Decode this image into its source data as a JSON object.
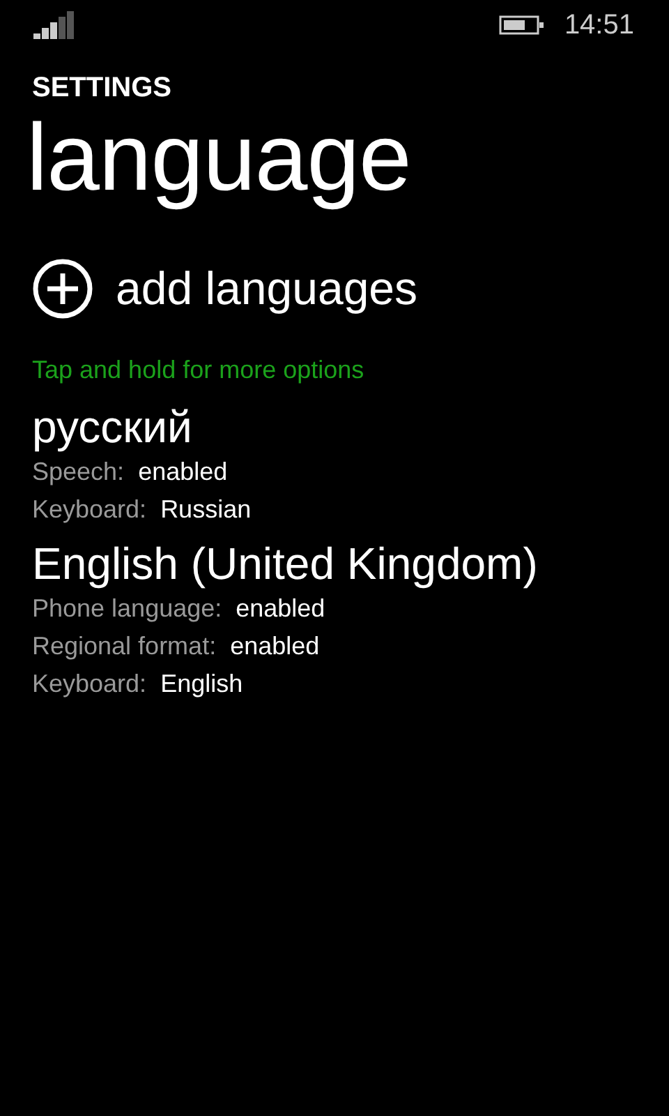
{
  "status_bar": {
    "time": "14:51"
  },
  "header": {
    "app_title": "SETTINGS",
    "page_title": "language"
  },
  "add_button": {
    "label": "add languages"
  },
  "hint": "Tap and hold for more options",
  "languages": [
    {
      "name": "русский",
      "details": [
        {
          "label": "Speech:",
          "value": "enabled"
        },
        {
          "label": "Keyboard:",
          "value": "Russian"
        }
      ]
    },
    {
      "name": "English (United Kingdom)",
      "details": [
        {
          "label": "Phone language:",
          "value": "enabled"
        },
        {
          "label": "Regional format:",
          "value": "enabled"
        },
        {
          "label": "Keyboard:",
          "value": "English"
        }
      ]
    }
  ]
}
